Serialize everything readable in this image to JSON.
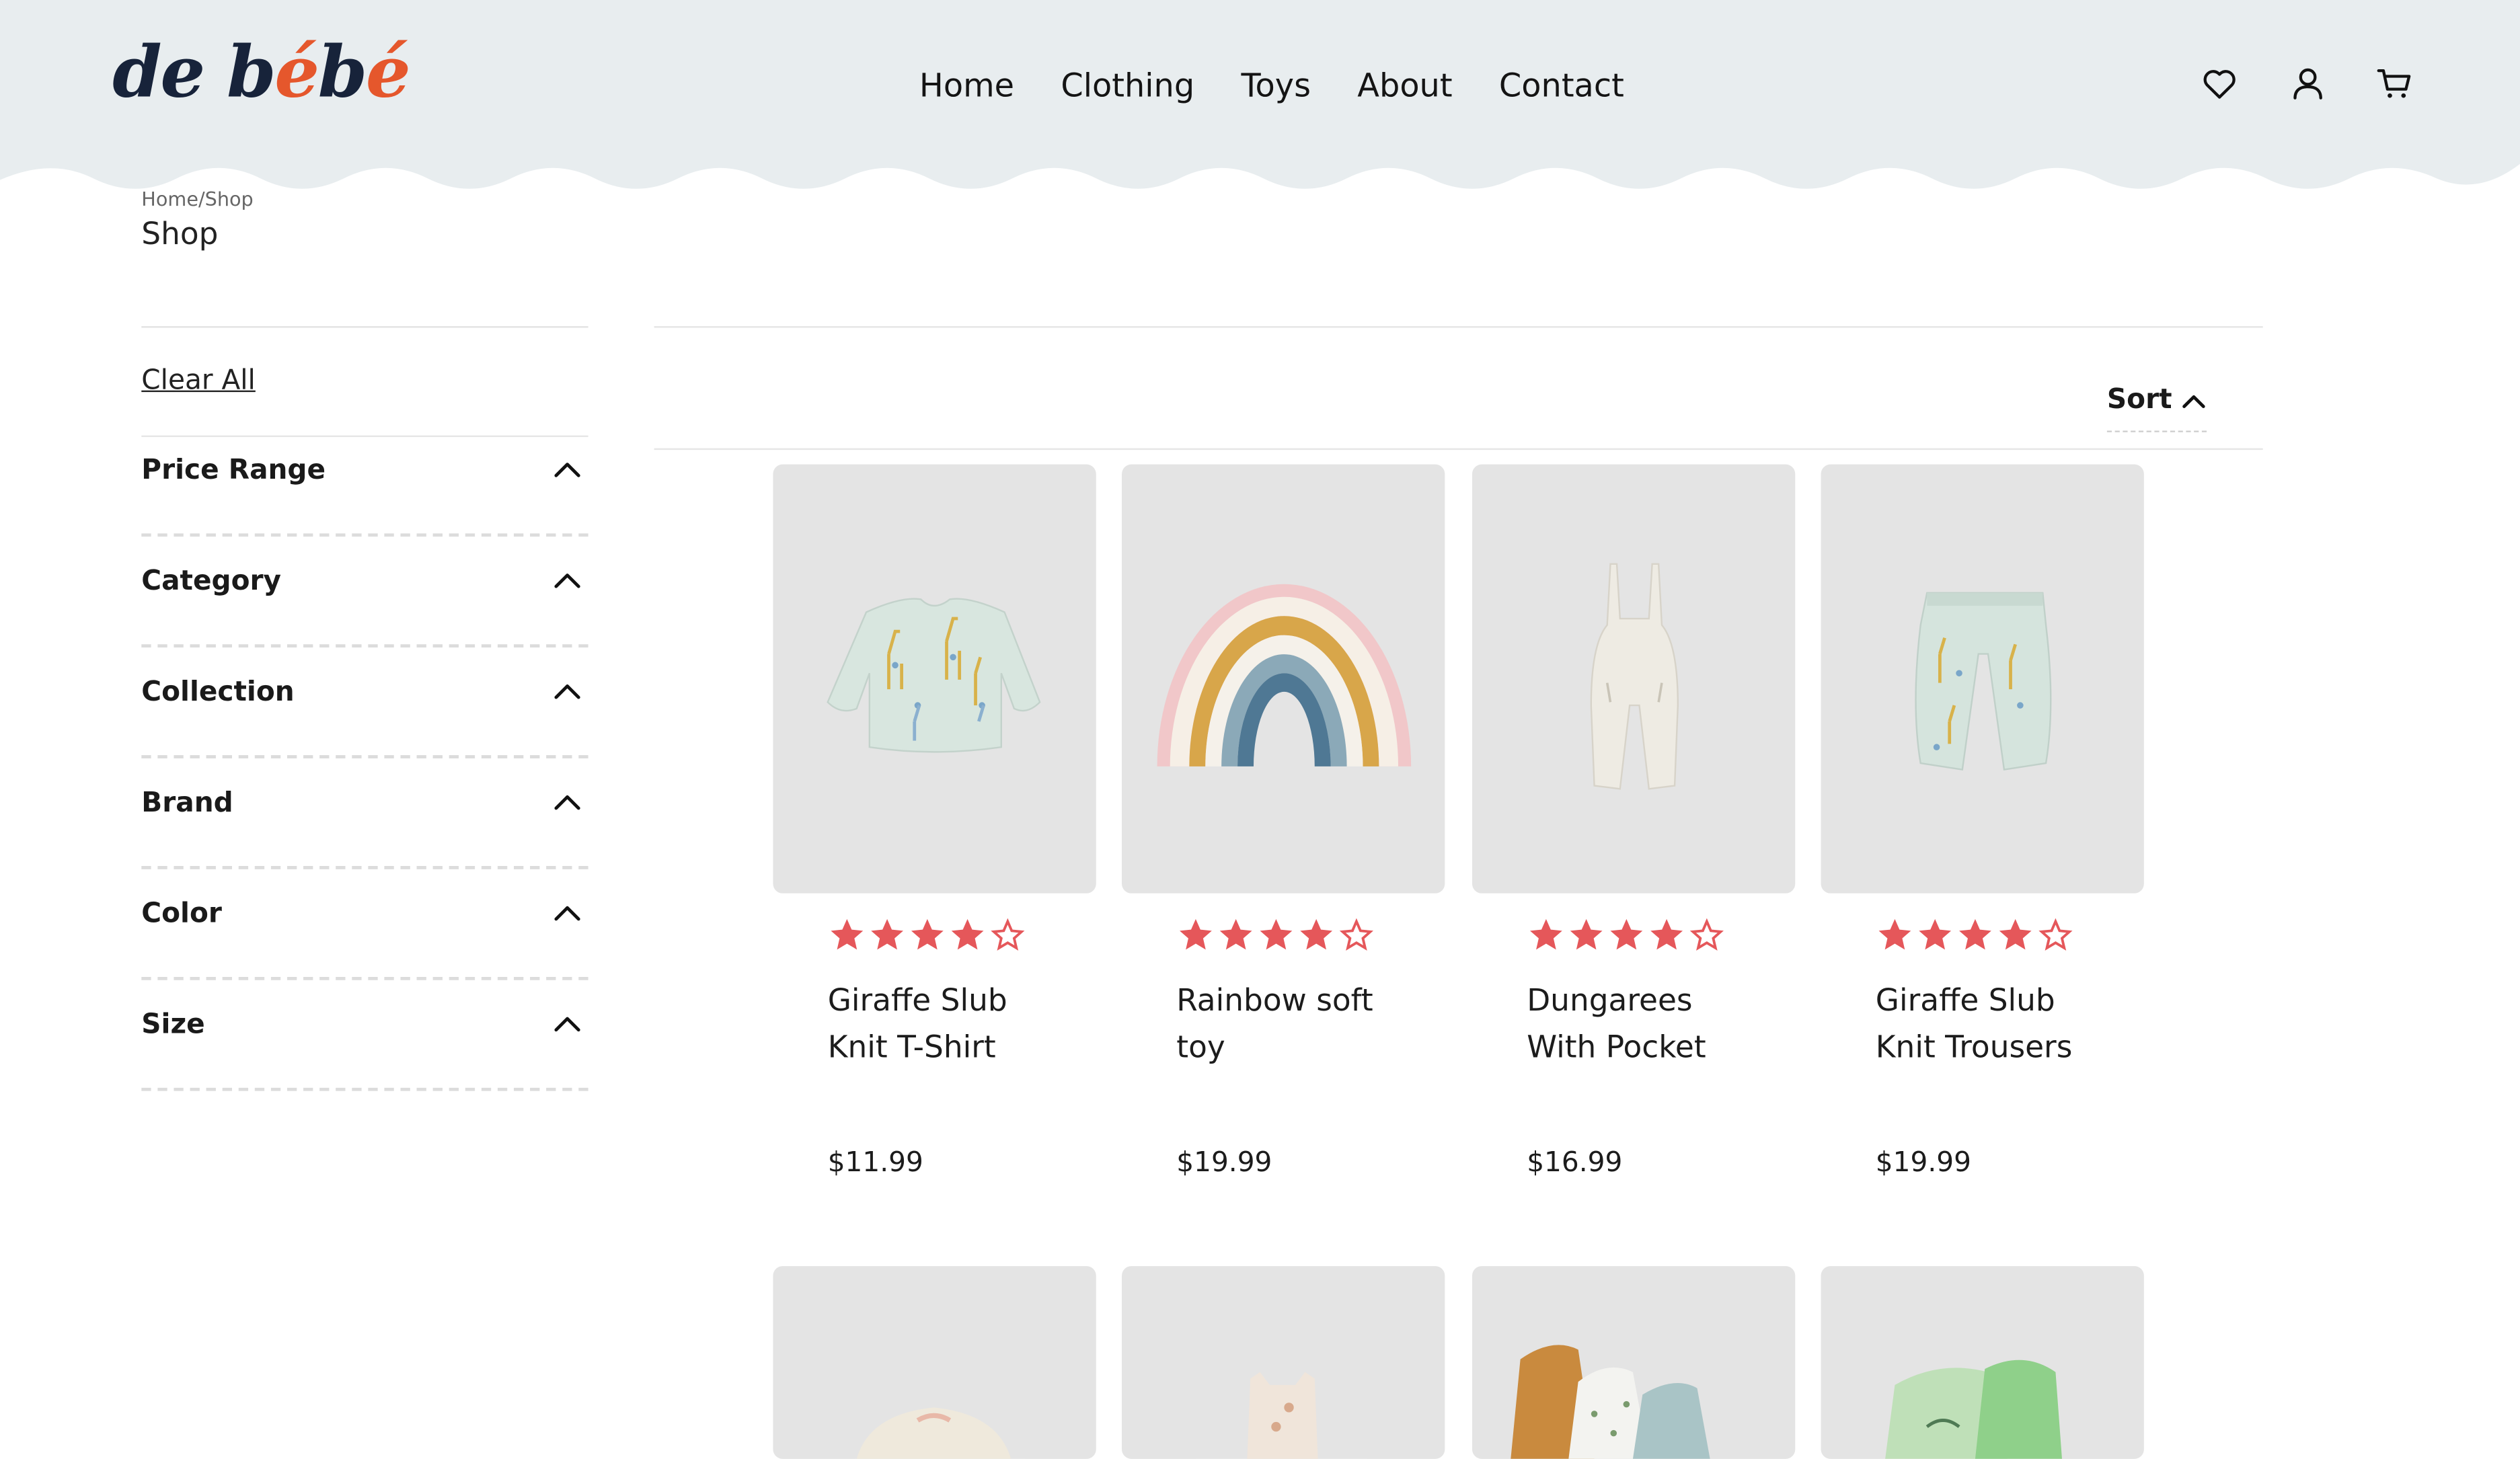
{
  "brand": {
    "logo_text_a": "de b",
    "logo_text_b": "é",
    "logo_text_c": "b",
    "logo_text_d": "é",
    "accent_color": "#e5572c"
  },
  "nav": [
    "Home",
    "Clothing",
    "Toys",
    "About",
    "Contact"
  ],
  "header_icons": [
    "heart-icon",
    "user-icon",
    "cart-icon"
  ],
  "breadcrumb": {
    "path": "Home/Shop",
    "title": "Shop"
  },
  "filters": {
    "clear_label": "Clear All",
    "facets": [
      "Price Range",
      "Category",
      "Collection",
      "Brand",
      "Color",
      "Size"
    ]
  },
  "toolbar": {
    "sort_label": "Sort"
  },
  "products": [
    {
      "name_line1": "Giraffe Slub",
      "name_line2": "Knit T-Shirt",
      "price": "$11.99",
      "rating": 4
    },
    {
      "name_line1": "Rainbow soft",
      "name_line2": "toy",
      "price": "$19.99",
      "rating": 4
    },
    {
      "name_line1": "Dungarees",
      "name_line2": "With Pocket",
      "price": "$16.99",
      "rating": 4
    },
    {
      "name_line1": "Giraffe Slub",
      "name_line2": "Knit Trousers",
      "price": "$19.99",
      "rating": 4
    }
  ],
  "colors": {
    "header_bg": "#e8edef",
    "star": "#e5575a",
    "card_bg": "#e4e4e4"
  }
}
